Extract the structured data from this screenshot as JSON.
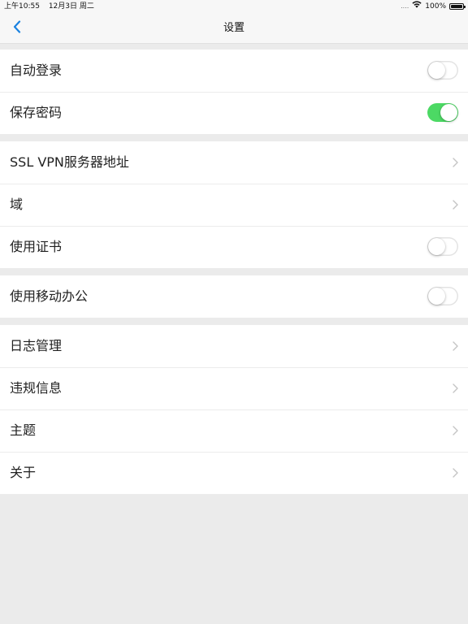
{
  "status_bar": {
    "time": "上午10:55",
    "date": "12月3日 周二",
    "signal": "....",
    "battery": "100%"
  },
  "nav": {
    "title": "设置",
    "back_icon": "chevron-left-icon"
  },
  "colors": {
    "accent": "#1a82e0",
    "toggle_on": "#4cd964",
    "group_separator": "#ebebeb"
  },
  "groups": [
    {
      "items": [
        {
          "label": "自动登录",
          "control": "toggle",
          "state": "off"
        },
        {
          "label": "保存密码",
          "control": "toggle",
          "state": "on"
        }
      ]
    },
    {
      "items": [
        {
          "label": "SSL VPN服务器地址",
          "control": "chevron"
        },
        {
          "label": "域",
          "control": "chevron"
        },
        {
          "label": "使用证书",
          "control": "toggle",
          "state": "off"
        }
      ]
    },
    {
      "items": [
        {
          "label": "使用移动办公",
          "control": "toggle",
          "state": "off"
        }
      ]
    },
    {
      "items": [
        {
          "label": "日志管理",
          "control": "chevron"
        },
        {
          "label": "违规信息",
          "control": "chevron"
        },
        {
          "label": "主题",
          "control": "chevron"
        },
        {
          "label": "关于",
          "control": "chevron"
        }
      ]
    }
  ]
}
